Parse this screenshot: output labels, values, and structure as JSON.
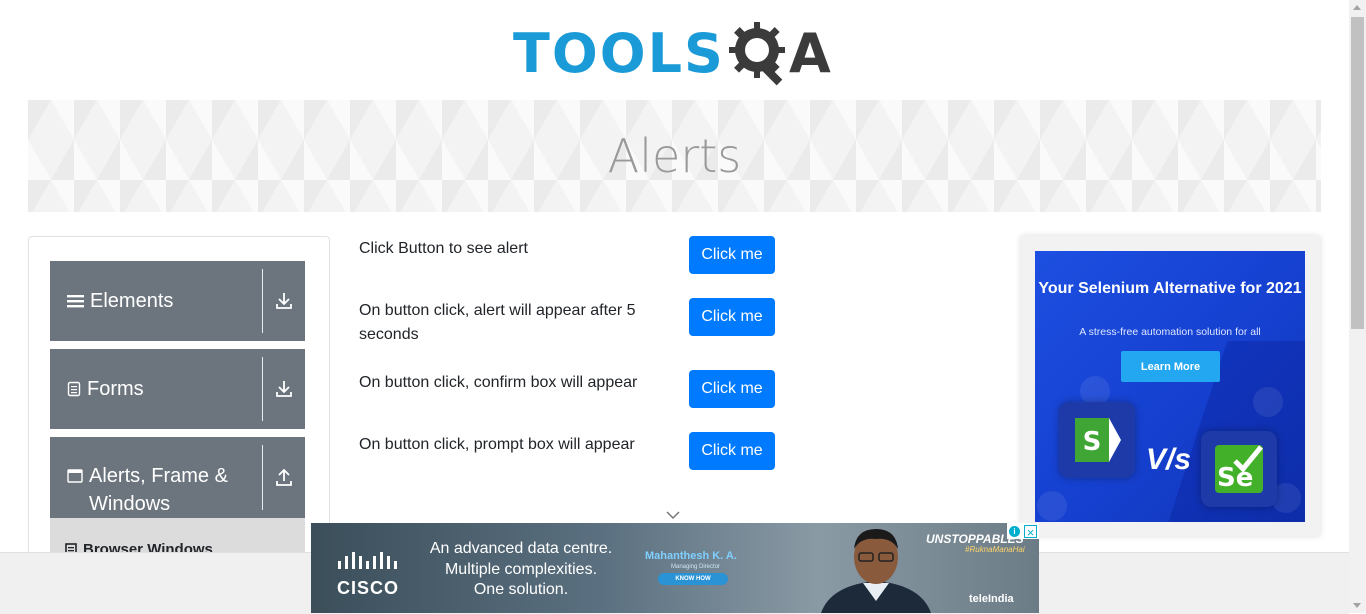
{
  "logo": {
    "tools": "TOOLS",
    "qa": "A",
    "brand_color": "#1a9bd7"
  },
  "banner": {
    "title": "Alerts"
  },
  "sidebar": {
    "groups": [
      {
        "label": "Elements",
        "icon": "hamburger-icon",
        "toggle_icon": "download-arrow-icon"
      },
      {
        "label": "Forms",
        "icon": "document-icon",
        "toggle_icon": "download-arrow-icon"
      },
      {
        "label": "Alerts, Frame &",
        "label2": "Windows",
        "icon": "window-icon",
        "toggle_icon": "upload-arrow-icon"
      }
    ],
    "sub_item": {
      "label": "Browser Windows",
      "icon": "file-icon"
    }
  },
  "main": {
    "rows": [
      {
        "label": "Click Button to see alert",
        "button": "Click me"
      },
      {
        "label": "On button click, alert will appear after 5 seconds",
        "button": "Click me"
      },
      {
        "label": "On button click, confirm box will appear",
        "button": "Click me"
      },
      {
        "label": "On button click, prompt box will appear",
        "button": "Click me"
      }
    ],
    "accent": "#007bff"
  },
  "right_ad": {
    "title": "Your Selenium Alternative for 2021",
    "subtitle": "A stress-free automation solution for all",
    "button": "Learn More",
    "vs": "V/s",
    "se": "Se"
  },
  "bottom_ad": {
    "brand": "CISCO",
    "line1": "An advanced data centre.",
    "line2": "Multiple complexities.",
    "line3": "One solution.",
    "person_name": "Mahanthesh K. A.",
    "person_role": "Managing Director",
    "know_how": "KNOW HOW",
    "campaign": "UNSTOPPABLES",
    "hashtag": "#RuknaManaHai",
    "partner": "teleIndia"
  }
}
